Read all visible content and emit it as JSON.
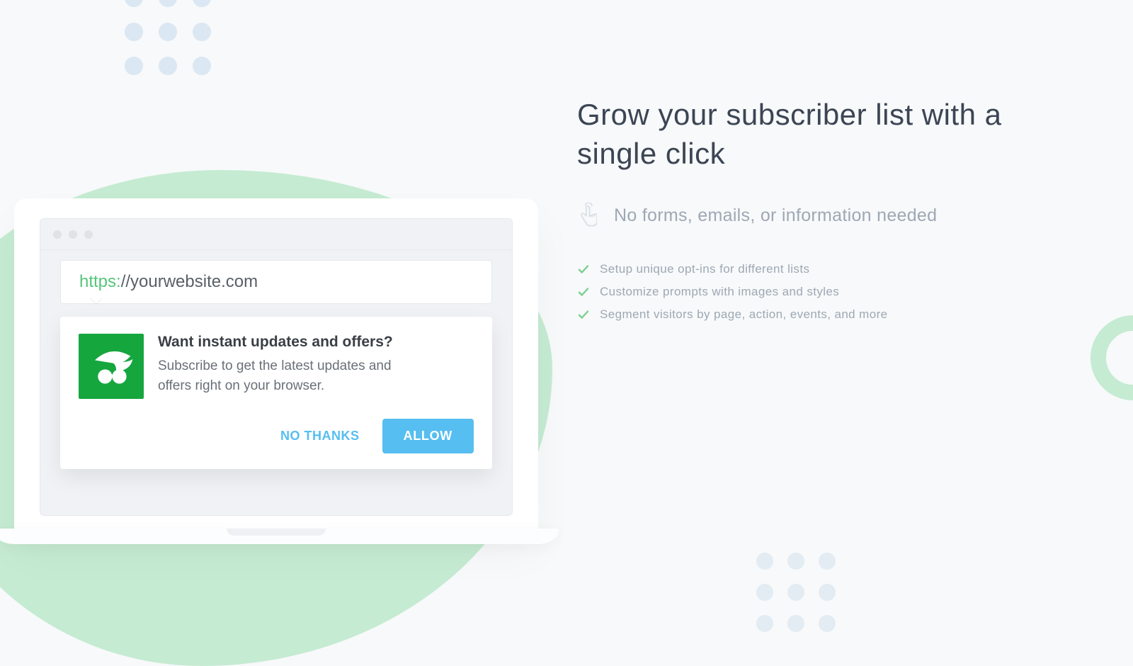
{
  "copy": {
    "headline": "Grow your subscriber list with a single click",
    "subline": "No forms, emails, or information needed",
    "features": [
      "Setup unique opt-ins for different lists",
      "Customize prompts with images and styles",
      "Segment visitors by page, action, events, and more"
    ]
  },
  "browser": {
    "url_scheme": "https:",
    "url_rest": "//yourwebsite.com",
    "prompt": {
      "title": "Want instant updates and offers?",
      "body": "Subscribe to get the latest updates and offers right on your browser.",
      "deny": "NO THANKS",
      "allow": "ALLOW"
    }
  },
  "colors": {
    "accent_green": "#55c57a",
    "accent_blue": "#56bef0",
    "blob": "#c5ebd2"
  }
}
